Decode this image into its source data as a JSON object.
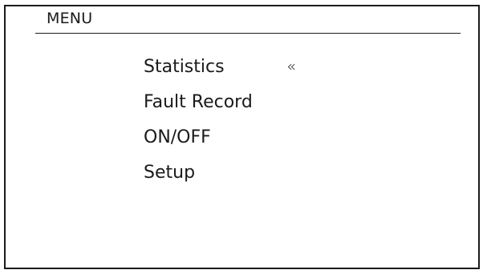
{
  "header": {
    "title": "MENU"
  },
  "menu": {
    "items": [
      {
        "label": "Statistics"
      },
      {
        "label": "Fault Record"
      },
      {
        "label": "ON/OFF"
      },
      {
        "label": "Setup"
      }
    ],
    "selected_index": 0,
    "selection_indicator": "«"
  },
  "icons": {
    "selection_indicator": "double-left-chevron-icon"
  },
  "colors": {
    "foreground": "#1a1a1a",
    "background": "#ffffff"
  }
}
